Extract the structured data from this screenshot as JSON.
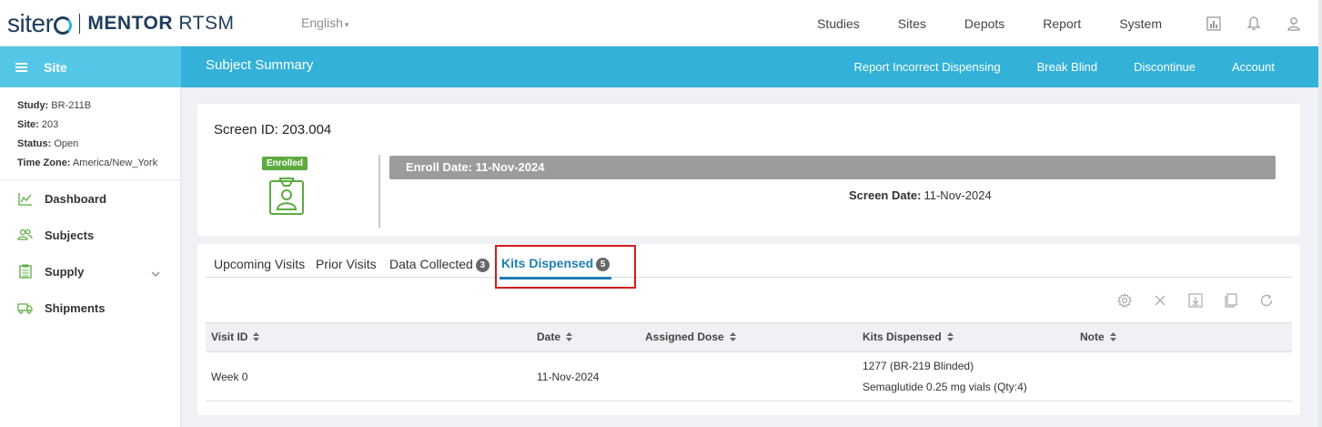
{
  "header": {
    "brand": "siter",
    "product_bold": "MENTOR",
    "product_rest": "RTSM",
    "language": "English",
    "nav": [
      "Studies",
      "Sites",
      "Depots",
      "Report",
      "System"
    ],
    "icons": [
      "chart-icon",
      "bell-icon",
      "user-icon"
    ]
  },
  "sidebar": {
    "title": "Site",
    "info": [
      {
        "label": "Study:",
        "value": "BR-211B"
      },
      {
        "label": "Site:",
        "value": "203"
      },
      {
        "label": "Status:",
        "value": "Open"
      },
      {
        "label": "Time Zone:",
        "value": "America/New_York"
      }
    ],
    "items": [
      {
        "label": "Dashboard",
        "icon": "chart-line-icon"
      },
      {
        "label": "Subjects",
        "icon": "users-icon"
      },
      {
        "label": "Supply",
        "icon": "clipboard-list-icon"
      },
      {
        "label": "Shipments",
        "icon": "truck-icon"
      }
    ]
  },
  "page": {
    "title": "Subject Summary",
    "actions": [
      "Report Incorrect Dispensing",
      "Break Blind",
      "Discontinue",
      "Account"
    ]
  },
  "summary": {
    "screen_id_label": "Screen ID:",
    "screen_id": "203.004",
    "status_badge": "Enrolled",
    "enroll_date": "Enroll Date: 11-Nov-2024",
    "screen_date_label": "Screen Date:",
    "screen_date": "11-Nov-2024"
  },
  "tabs": [
    {
      "label": "Upcoming Visits",
      "count": ""
    },
    {
      "label": "Prior Visits",
      "count": ""
    },
    {
      "label": "Data Collected",
      "count": "3"
    },
    {
      "label": "Kits Dispensed",
      "count": "5",
      "active": true
    }
  ],
  "toolbar": [
    "settings-icon",
    "close-icon",
    "download-icon",
    "copy-icon",
    "refresh-icon"
  ],
  "table": {
    "columns": [
      "Visit ID",
      "Date",
      "Assigned Dose",
      "Kits Dispensed",
      "Note"
    ],
    "rows": [
      {
        "visit_id": "Week 0",
        "date": "11-Nov-2024",
        "assigned_dose": "",
        "kits": [
          "1277 (BR-219 Blinded)",
          "Semaglutide 0.25 mg vials (Qty:4)"
        ],
        "note": ""
      }
    ]
  },
  "colors": {
    "header_blue": "#33b1d8",
    "sidebar_head": "#55c7e6",
    "enrolled_green": "#5cab3f",
    "active_tab": "#1f7fb5",
    "highlight_red": "#d61a1a"
  }
}
